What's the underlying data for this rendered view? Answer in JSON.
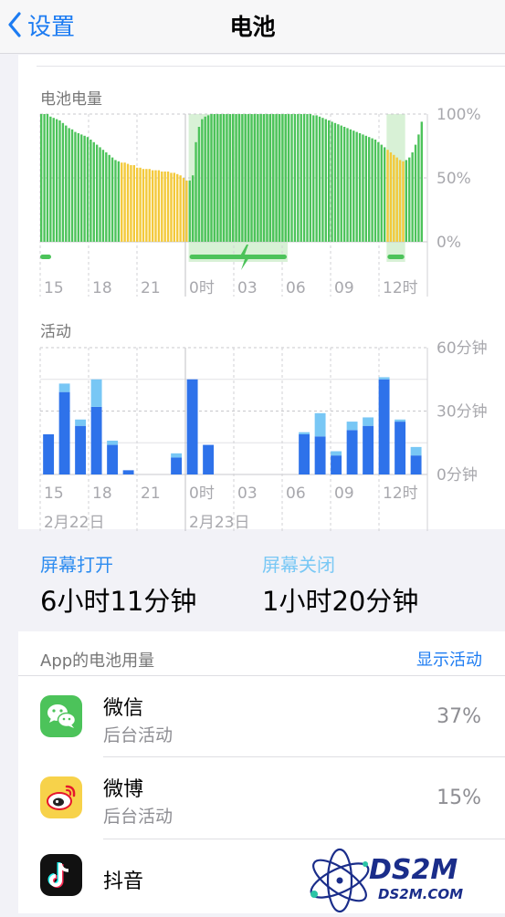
{
  "nav": {
    "back_label": "设置",
    "title": "电池"
  },
  "battery_chart": {
    "title": "电池电量",
    "y_labels": [
      "100%",
      "50%",
      "0%"
    ],
    "x_labels": [
      "15",
      "18",
      "21",
      "0时",
      "03",
      "06",
      "09",
      "12时"
    ],
    "colors": {
      "normal": "#4cc35a",
      "low_power": "#f3c93a",
      "charging_bg": "#d8f1d6",
      "charging_bar": "#4cc35a"
    },
    "charging_icon": "lightning-bolt-icon"
  },
  "activity_chart": {
    "title": "活动",
    "y_labels": [
      "60分钟",
      "30分钟",
      "0分钟"
    ],
    "x_labels": [
      "15",
      "18",
      "21",
      "0时",
      "03",
      "06",
      "09",
      "12时"
    ],
    "date_labels": [
      "2月22日",
      "2月23日"
    ],
    "colors": {
      "screen_on": "#2e72ea",
      "screen_off": "#78c7f5"
    }
  },
  "chart_data": [
    {
      "type": "bar",
      "title": "电池电量",
      "ylim": [
        0,
        100
      ],
      "x_ticks": [
        "15",
        "18",
        "21",
        "0时",
        "03",
        "06",
        "09",
        "12时"
      ],
      "series": [
        {
          "values": [
            100,
            100,
            100,
            98,
            97,
            96,
            95,
            93,
            91,
            89,
            88,
            86,
            85,
            84,
            83,
            82,
            80,
            78,
            76,
            74,
            72,
            70,
            68,
            66,
            64,
            63,
            62,
            62,
            61,
            60,
            60,
            58,
            58,
            57,
            57,
            57,
            56,
            56,
            56,
            55,
            55,
            55,
            54,
            54,
            53,
            52,
            50,
            48,
            48,
            52,
            78,
            90,
            96,
            98,
            99,
            100,
            100,
            100,
            100,
            100,
            100,
            100,
            100,
            100,
            100,
            100,
            100,
            100,
            100,
            100,
            100,
            100,
            100,
            100,
            100,
            100,
            100,
            100,
            100,
            100,
            100,
            100,
            100,
            100,
            100,
            100,
            100,
            100,
            99,
            99,
            98,
            97,
            96,
            95,
            94,
            93,
            92,
            91,
            90,
            89,
            88,
            87,
            86,
            85,
            84,
            83,
            82,
            81,
            80,
            78,
            76,
            74,
            72,
            70,
            68,
            66,
            64,
            63,
            64,
            66,
            70,
            76,
            84,
            94
          ]
        }
      ],
      "low_power_ranges": [
        [
          26,
          48
        ],
        [
          112,
          118
        ]
      ],
      "charging_ranges": [
        [
          48,
          80
        ],
        [
          112,
          118
        ]
      ]
    },
    {
      "type": "bar",
      "title": "活动",
      "ylim": [
        0,
        60
      ],
      "x_ticks": [
        "15",
        "18",
        "21",
        "0时",
        "03",
        "06",
        "09",
        "12时"
      ],
      "series": [
        {
          "name": "屏幕打开",
          "values": [
            19,
            39,
            23,
            32,
            14,
            2,
            0,
            0,
            8,
            45,
            14,
            0,
            0,
            0,
            0,
            0,
            19,
            18,
            9,
            21,
            23,
            45,
            25,
            9
          ]
        },
        {
          "name": "屏幕关闭",
          "values": [
            0,
            4,
            3,
            13,
            2,
            0,
            0,
            0,
            2,
            0,
            0,
            0,
            0,
            0,
            0,
            0,
            1,
            11,
            2,
            4,
            4,
            1,
            1,
            4
          ]
        }
      ]
    }
  ],
  "screen": {
    "on_label": "屏幕打开",
    "on_value": "6小时11分钟",
    "off_label": "屏幕关闭",
    "off_value": "1小时20分钟"
  },
  "apps": {
    "title": "App的电池用量",
    "show_activity": "显示活动",
    "items": [
      {
        "name": "微信",
        "sub": "后台活动",
        "pct": "37%",
        "icon": "wechat-icon"
      },
      {
        "name": "微博",
        "sub": "后台活动",
        "pct": "15%",
        "icon": "weibo-icon"
      },
      {
        "name": "抖音",
        "sub": "",
        "pct": "",
        "icon": "douyin-icon"
      }
    ]
  },
  "watermark": {
    "text1": "DS2M",
    "text2": "DS2M.COM"
  }
}
